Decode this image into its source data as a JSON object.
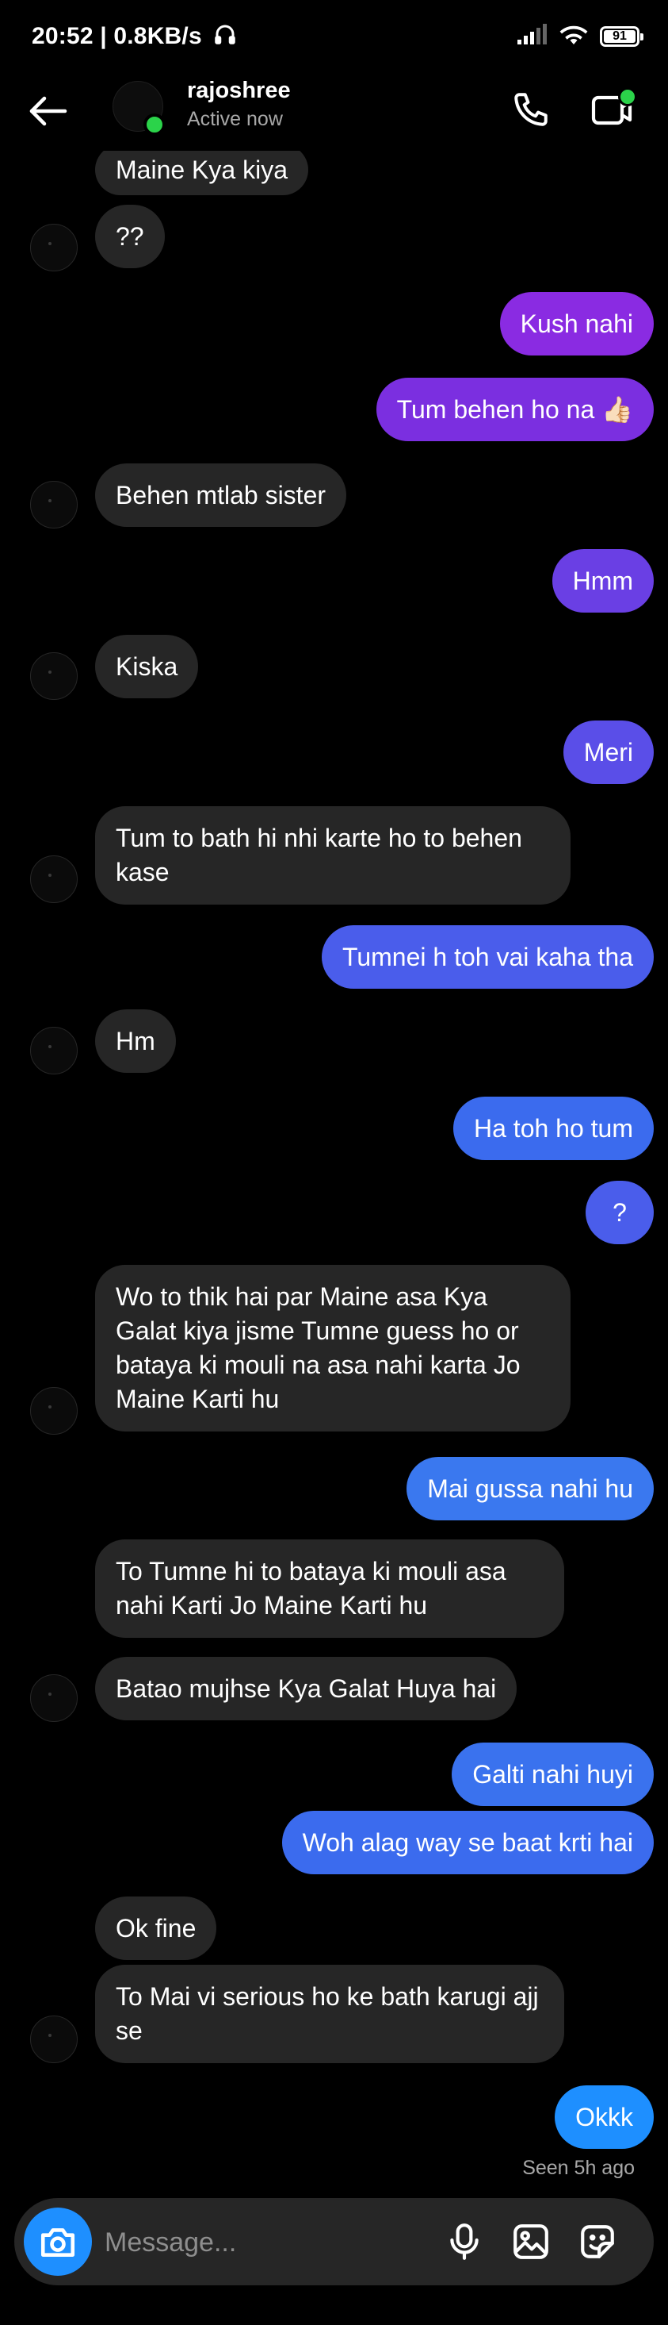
{
  "status_bar": {
    "time_speed": "20:52 | 0.8KB/s",
    "battery": "91"
  },
  "header": {
    "name": "rajoshree",
    "status": "Active now"
  },
  "messages": [
    {
      "text": "Maine Kya kiya"
    },
    {
      "text": "??"
    },
    {
      "text": "Kush nahi"
    },
    {
      "text": "Tum behen ho na 👍🏻"
    },
    {
      "text": "Behen mtlab sister"
    },
    {
      "text": "Hmm"
    },
    {
      "text": "Kiska"
    },
    {
      "text": "Meri"
    },
    {
      "text": "Tum to bath hi nhi karte ho to behen kase"
    },
    {
      "text": "Tumnei h toh vai kaha tha"
    },
    {
      "text": "Hm"
    },
    {
      "text": "Ha toh ho tum"
    },
    {
      "text": "?"
    },
    {
      "text": "Wo to thik hai par Maine asa Kya Galat kiya jisme Tumne guess ho or bataya ki mouli na asa nahi karta Jo Maine Karti hu"
    },
    {
      "text": "Mai gussa nahi hu"
    },
    {
      "text": "To Tumne hi to bataya ki mouli asa nahi Karti Jo Maine Karti hu"
    },
    {
      "text": "Batao mujhse Kya Galat Huya hai"
    },
    {
      "text": "Galti nahi huyi"
    },
    {
      "text": "Woh alag way se baat krti hai"
    },
    {
      "text": "Ok fine"
    },
    {
      "text": "To Mai vi serious ho ke bath karugi ajj se"
    },
    {
      "text": "Okkk"
    }
  ],
  "seen_text": "Seen 5h ago",
  "composer": {
    "placeholder": "Message..."
  },
  "icons": {
    "back": "arrow-left-icon",
    "call": "phone-icon",
    "video": "video-camera-icon",
    "camera": "camera-icon",
    "mic": "microphone-icon",
    "gallery": "image-icon",
    "sticker": "sticker-icon",
    "signal": "signal-icon",
    "wifi": "wifi-icon",
    "headphones": "headphones-icon"
  },
  "colors": {
    "incoming_bubble": "#262626",
    "outgoing_gradient": [
      "#8a2be2",
      "#7b2fe0",
      "#6a3fe4",
      "#5a4ee8",
      "#4a5deb",
      "#3b6bee",
      "#3a78ef",
      "#1e8fff"
    ],
    "online_dot": "#2bd34a",
    "camera_button": "#1e8fff"
  }
}
